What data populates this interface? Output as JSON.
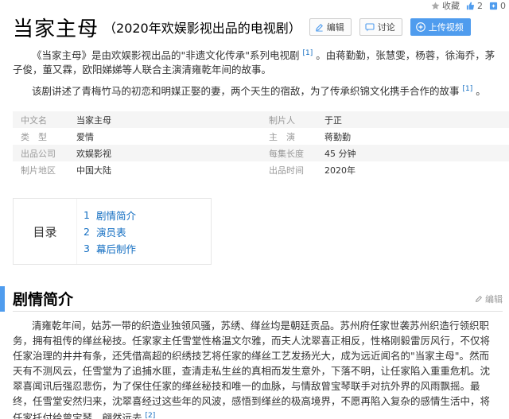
{
  "topbar": {
    "favorite_label": "收藏",
    "like_count": "2",
    "extra_count": "0"
  },
  "title": {
    "main": "当家主母",
    "sub": "（2020年欢娱影视出品的电视剧）",
    "edit_label": "编辑",
    "discuss_label": "讨论",
    "upload_label": "上传视频"
  },
  "summary": {
    "p1": "《当家主母》是由欢娱影视出品的\"非遗文化传承\"系列电视剧",
    "p1_ref": "[1]",
    "p1_tail": "。由蒋勤勤，张慧雯，杨蓉，徐海乔，茅子俊，董又霖，欧阳娣娣等人联合主演清雍乾年间的故事。",
    "p2": "该剧讲述了青梅竹马的初恋和明媒正娶的妻，两个天生的宿敌，为了传承织锦文化携手合作的故事",
    "p2_ref": "[1]",
    "p2_tail": "。"
  },
  "info": [
    {
      "k1": "中文名",
      "v1": "当家主母",
      "k2": "制片人",
      "v2": "于正"
    },
    {
      "k1": "类　型",
      "v1": "爱情",
      "k2": "主　演",
      "v2": "蒋勤勤"
    },
    {
      "k1": "出品公司",
      "v1": "欢娱影视",
      "k2": "每集长度",
      "v2": "45 分钟"
    },
    {
      "k1": "制片地区",
      "v1": "中国大陆",
      "k2": "出品时间",
      "v2": "2020年"
    }
  ],
  "toc": {
    "label": "目录",
    "items": [
      {
        "num": "1",
        "label": "剧情简介"
      },
      {
        "num": "2",
        "label": "演员表"
      },
      {
        "num": "3",
        "label": "幕后制作"
      }
    ]
  },
  "section": {
    "title": "剧情简介",
    "edit_label": "编辑"
  },
  "plot": {
    "text": "清雍乾年间，姑苏一带的织造业独领风骚，苏绣、缂丝均是朝廷贡品。苏州府任家世袭苏州织造行领织职务，拥有祖传的缂丝秘技。任家家主任雪堂性格温文尔雅，而夫人沈翠喜正相反，性格刚毅雷厉风行，不仅将任家治理的井井有条，还凭借高超的织绣技艺将任家的缂丝工艺发扬光大，成为远近闻名的\"当家主母\"。然而天有不测风云，任雪堂为了追捕水匪，查清走私生丝的真相而发生意外，下落不明，让任家陷入重重危机。沈翠喜闻讯后强忍悲伤，为了保住任家的缂丝秘技和唯一的血脉，与情敌曾宝琴联手对抗外界的风雨飘摇。最终，任雪堂安然归来，沈翠喜经过这些年的风波，感悟到缂丝的极高境界，不愿再陷入复杂的感情生活中，将任家托付给曾宝琴，翩然远去",
    "ref": "[2]",
    "tail": "。"
  },
  "colors": {
    "accent": "#4f9cee",
    "link": "#136ec2"
  }
}
